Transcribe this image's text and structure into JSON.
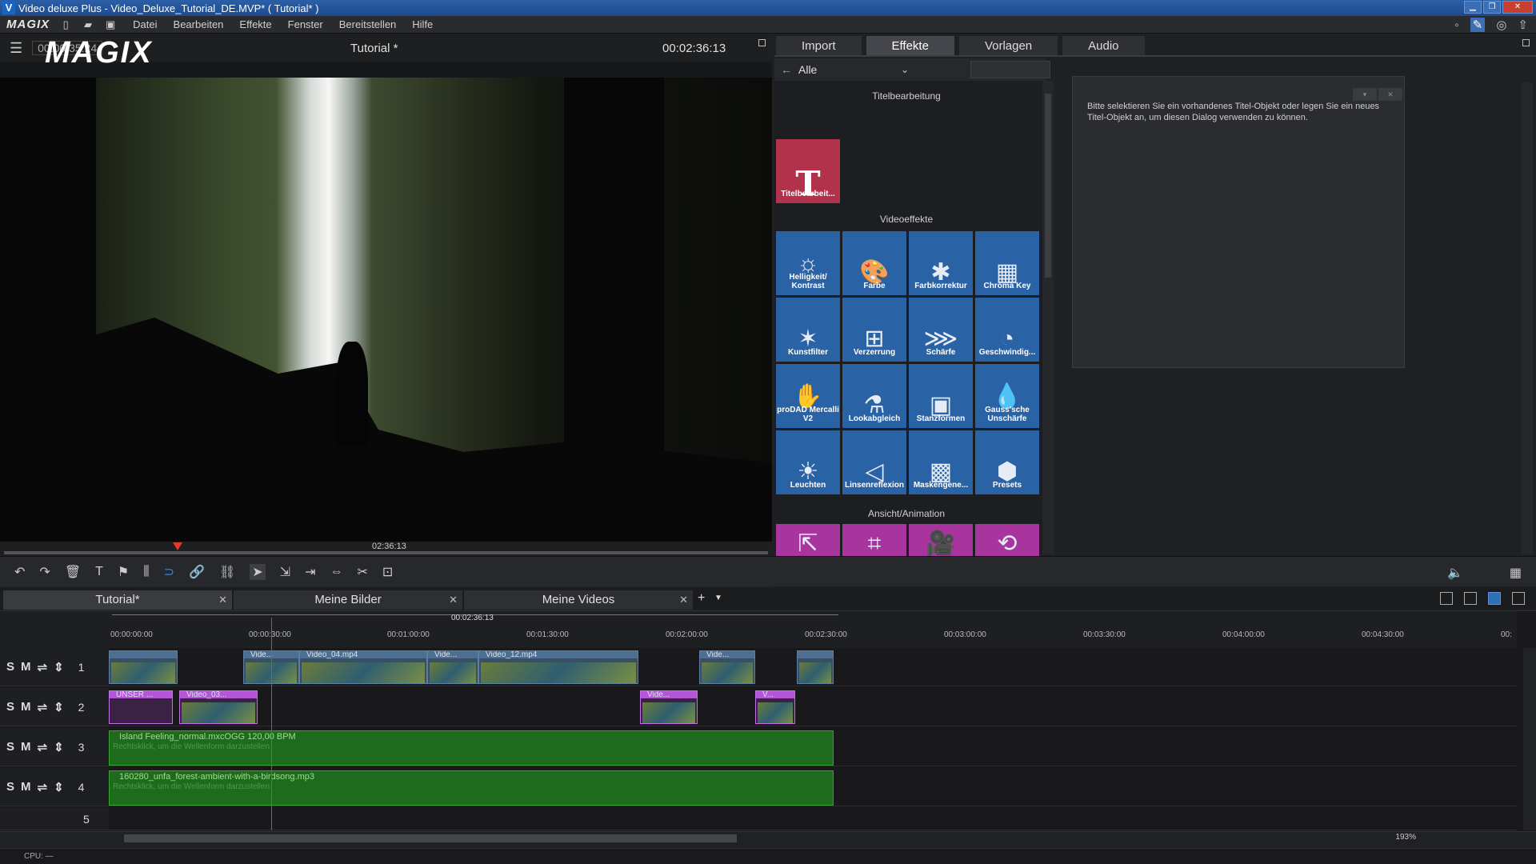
{
  "window": {
    "title": "Video deluxe Plus - Video_Deluxe_Tutorial_DE.MVP* ( Tutorial* )"
  },
  "menu": {
    "brand": "MAGIX",
    "items": [
      "Datei",
      "Bearbeiten",
      "Effekte",
      "Fenster",
      "Bereitstellen",
      "Hilfe"
    ]
  },
  "preview": {
    "timecode_left": "00:00:35:24",
    "logo": "MAGIX",
    "title": "Tutorial *",
    "time": "00:02:36:13",
    "scrub_time": "02:36:13"
  },
  "panel": {
    "tabs": [
      "Import",
      "Effekte",
      "Vorlagen",
      "Audio"
    ],
    "active_tab": "Effekte",
    "filter": "Alle",
    "sections": {
      "title_edit": "Titelbearbeitung",
      "video_effects": "Videoeffekte",
      "view_anim": "Ansicht/Animation"
    },
    "title_tile": "Titelbearbeit...",
    "video_tiles": [
      "Helligkeit/ Kontrast",
      "Farbe",
      "Farbkorrektur",
      "Chroma Key",
      "Kunstfilter",
      "Verzerrung",
      "Schärfe",
      "Geschwindig...",
      "proDAD Mercalli V2",
      "Lookabgleich",
      "Stanzformen",
      "Gauss'sche Unschärfe",
      "Leuchten",
      "Linsenreflexion",
      "Maskengene...",
      "Presets"
    ],
    "dialog_text": "Bitte selektieren Sie ein vorhandenes Titel-Objekt oder legen Sie ein neues Titel-Objekt an, um diesen Dialog verwenden zu können."
  },
  "timeline": {
    "tabs": [
      "Tutorial*",
      "Meine Bilder",
      "Meine Videos"
    ],
    "selection_time": "00:02:36:13",
    "ruler": [
      "00:00:00:00",
      "00:00:30:00",
      "00:01:00:00",
      "00:01:30:00",
      "00:02:00:00",
      "00:02:30:00",
      "00:03:00:00",
      "00:03:30:00",
      "00:04:00:00",
      "00:04:30:00",
      "00:"
    ],
    "tracks": [
      {
        "num": "1",
        "clips": [
          "",
          "Vide...",
          "Video_04.mp4",
          "Vide...",
          "Video_12.mp4",
          "Vide...",
          ""
        ]
      },
      {
        "num": "2",
        "clips": [
          "UNSER ...",
          "Video_03...",
          "Vide...",
          "V..."
        ]
      },
      {
        "num": "3",
        "clips": [
          "Island Feeling_normal.mxcOGG  120,00 BPM"
        ],
        "sub": "Rechtsklick, um die Wellenform darzustellen"
      },
      {
        "num": "4",
        "clips": [
          "160280_unfa_forest-ambient-with-a-birdsong.mp3"
        ],
        "sub": "Rechtsklick, um die Wellenform darzustellen"
      },
      {
        "num": "5"
      }
    ],
    "track_buttons": {
      "s": "S",
      "m": "M"
    },
    "zoom": "193%"
  },
  "status": {
    "cpu": "CPU: —"
  }
}
